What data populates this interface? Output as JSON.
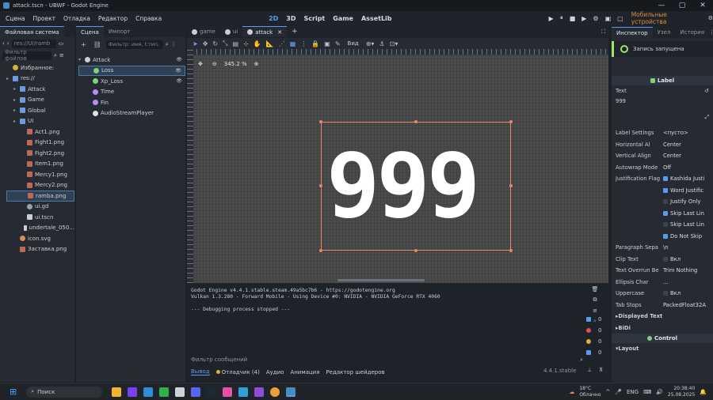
{
  "window": {
    "title": "attack.tscn - UBWF - Godot Engine",
    "controls": [
      "—",
      "▢",
      "✕"
    ]
  },
  "menu": [
    "Сцена",
    "Проект",
    "Отладка",
    "Редактор",
    "Справка"
  ],
  "workspaces": [
    {
      "label": "2D",
      "active": true
    },
    {
      "label": "3D",
      "active": false
    },
    {
      "label": "Script",
      "active": false
    },
    {
      "label": "Game",
      "active": false
    },
    {
      "label": "AssetLib",
      "active": false
    }
  ],
  "run_buttons": [
    "▶",
    "⏸",
    "■",
    "▶",
    "⚙",
    "▣",
    "▢"
  ],
  "mobile_label": "Мобильные устройства",
  "filesystem": {
    "tabs": [
      "Файловая система"
    ],
    "path": "res://UI/ramb",
    "filter_placeholder": "Фильтр файлов",
    "items": [
      {
        "label": "Избранное:",
        "indent": 0,
        "type": "star"
      },
      {
        "label": "res://",
        "indent": 0,
        "type": "folder"
      },
      {
        "label": "Attack",
        "indent": 1,
        "type": "folder"
      },
      {
        "label": "Game",
        "indent": 1,
        "type": "folder"
      },
      {
        "label": "Global",
        "indent": 1,
        "type": "folder"
      },
      {
        "label": "UI",
        "indent": 1,
        "type": "folder"
      },
      {
        "label": "Act1.png",
        "indent": 2,
        "type": "png"
      },
      {
        "label": "Fight1.png",
        "indent": 2,
        "type": "png"
      },
      {
        "label": "Fight2.png",
        "indent": 2,
        "type": "png"
      },
      {
        "label": "Item1.png",
        "indent": 2,
        "type": "png"
      },
      {
        "label": "Mercy1.png",
        "indent": 2,
        "type": "png"
      },
      {
        "label": "Mercy2.png",
        "indent": 2,
        "type": "png"
      },
      {
        "label": "ramba.png",
        "indent": 2,
        "type": "png",
        "selected": true
      },
      {
        "label": "ui.gd",
        "indent": 2,
        "type": "gd"
      },
      {
        "label": "ui.tscn",
        "indent": 2,
        "type": "tscn"
      },
      {
        "label": "undertale_050...",
        "indent": 2,
        "type": "tscn"
      },
      {
        "label": "icon.svg",
        "indent": 1,
        "type": "svg"
      },
      {
        "label": "Заставка.png",
        "indent": 1,
        "type": "png"
      }
    ]
  },
  "scene": {
    "tabs": [
      "Сцена",
      "Импорт"
    ],
    "filter_placeholder": "Фильтр: имя, t:тип,",
    "nodes": [
      {
        "label": "Attack",
        "indent": 0,
        "color": "#c9ced6"
      },
      {
        "label": "Loss",
        "indent": 1,
        "color": "#7fd07f",
        "selected": true
      },
      {
        "label": "Xp_Loss",
        "indent": 1,
        "color": "#7fd07f"
      },
      {
        "label": "Time",
        "indent": 1,
        "color": "#b68ef0"
      },
      {
        "label": "Fin",
        "indent": 1,
        "color": "#b68ef0"
      },
      {
        "label": "AudioStreamPlayer",
        "indent": 1,
        "color": "#e0e0e0"
      }
    ]
  },
  "editor_tabs": [
    {
      "label": "game"
    },
    {
      "label": "ui"
    },
    {
      "label": "attack",
      "active": true
    }
  ],
  "toolbar": {
    "view_label": "Вид"
  },
  "viewport": {
    "zoom": "345.2 %",
    "text": "999"
  },
  "output": {
    "lines": [
      "Godot Engine v4.4.1.stable.steam.49a5bc7b6 - https://godotengine.org",
      "Vulkan 1.3.280 - Forward Mobile - Using Device #0: NVIDIA - NVIDIA GeForce RTX 4060",
      "",
      "--- Debugging process stopped ---"
    ],
    "filter_placeholder": "Фильтр сообщений",
    "counts": [
      "0",
      "0",
      "0",
      "0"
    ],
    "bottom_tabs": [
      {
        "label": "Вывод",
        "active": true
      },
      {
        "label": "Отладчик (4)",
        "warn": true
      },
      {
        "label": "Аудио"
      },
      {
        "label": "Анимация"
      },
      {
        "label": "Редактор шейдеров"
      }
    ],
    "version": "4.4.1.stable"
  },
  "inspector": {
    "tabs": [
      "Инспектор",
      "Узел",
      "История"
    ],
    "recording": "Запись запущена",
    "node_type": "Label",
    "text_label": "Text",
    "text_value": "999",
    "props": [
      {
        "label": "Label Settings",
        "value": "<пусто>"
      },
      {
        "label": "Horizontal Al",
        "value": "Center"
      },
      {
        "label": "Vertical Align",
        "value": "Center"
      },
      {
        "label": "Autowrap Mode",
        "value": "Off"
      },
      {
        "label": "Justification Flag",
        "value": "Kashida Justi",
        "check": true,
        "blue": true
      },
      {
        "label": "",
        "value": "Word Justific",
        "check": true,
        "blue": true
      },
      {
        "label": "",
        "value": "Justify Only",
        "check": false
      },
      {
        "label": "",
        "value": "Skip Last Lin",
        "check": true,
        "blue": true
      },
      {
        "label": "",
        "value": "Skip Last Lin",
        "check": false
      },
      {
        "label": "",
        "value": "Do Not Skip",
        "check": true,
        "blue": true
      },
      {
        "label": "Paragraph Sepa",
        "value": "\\n"
      },
      {
        "label": "Clip Text",
        "value": "Вкл",
        "check": false
      },
      {
        "label": "Text Overrun Be",
        "value": "Trim Nothing"
      },
      {
        "label": "Ellipsis Char",
        "value": "..."
      },
      {
        "label": "Uppercase",
        "value": "Вкл",
        "check": false
      },
      {
        "label": "Tab Stops",
        "value": "PackedFloat32A"
      }
    ],
    "groups": [
      "Displayed Text",
      "BiDi"
    ],
    "section2": "Control",
    "layout": "Layout"
  },
  "taskbar": {
    "search": "Поиск",
    "weather_temp": "18°C",
    "weather_desc": "Облачно",
    "lang": "ENG",
    "time": "20:38:40",
    "date": "25.08.2025"
  }
}
